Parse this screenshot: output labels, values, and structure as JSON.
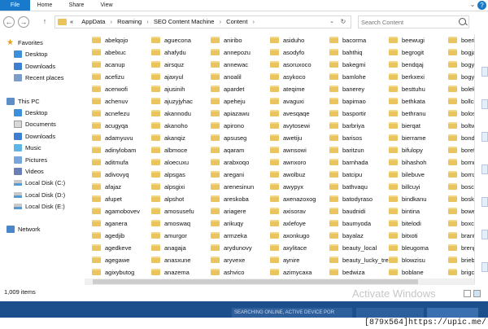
{
  "ribbon": {
    "tabs": [
      "File",
      "Home",
      "Share",
      "View"
    ],
    "help_label": "?"
  },
  "nav": {
    "back_glyph": "←",
    "forward_glyph": "→",
    "up_glyph": "↑",
    "breadcrumb": [
      "«",
      "AppData",
      "Roaming",
      "SEO Content Machine",
      "Content"
    ],
    "search_placeholder": "Search Content"
  },
  "sidebar": {
    "items": [
      {
        "label": "Favorites",
        "icon": "star-icon"
      },
      {
        "label": "Desktop",
        "icon": "desktop-icon"
      },
      {
        "label": "Downloads",
        "icon": "downloads-icon"
      },
      {
        "label": "Recent places",
        "icon": "recent-places-icon"
      },
      {
        "label": "This PC",
        "icon": "computer-icon"
      },
      {
        "label": "Desktop",
        "icon": "desktop-icon"
      },
      {
        "label": "Documents",
        "icon": "documents-icon"
      },
      {
        "label": "Downloads",
        "icon": "downloads-icon"
      },
      {
        "label": "Music",
        "icon": "music-icon"
      },
      {
        "label": "Pictures",
        "icon": "pictures-icon"
      },
      {
        "label": "Videos",
        "icon": "videos-icon"
      },
      {
        "label": "Local Disk (C:)",
        "icon": "disk-icon"
      },
      {
        "label": "Local Disk (D:)",
        "icon": "disk-icon"
      },
      {
        "label": "Local Disk (E:)",
        "icon": "disk-icon"
      },
      {
        "label": "Network",
        "icon": "network-icon"
      }
    ]
  },
  "folders": {
    "columns": [
      [
        "abelqojo",
        "abelxuc",
        "acanup",
        "acefizu",
        "acerwofi",
        "achenuv",
        "acnefezu",
        "acugyqa",
        "adamyuvu",
        "adinylobam",
        "aditmufa",
        "adivovyq",
        "afajaz",
        "afupet",
        "agamobovev",
        "aganera",
        "agedjib",
        "agedkeve",
        "agegawe",
        "agixybutog"
      ],
      [
        "aguecona",
        "ahafydu",
        "airsquz",
        "ajaxyul",
        "ajusinih",
        "ajuzyjyhac",
        "akannodu",
        "akanoho",
        "akanqiz",
        "albmoce",
        "aloecuxu",
        "alpsgas",
        "alpsgixi",
        "alpshot",
        "amosusefu",
        "amoswaq",
        "amurgor",
        "anagaja",
        "anasxune",
        "anazema"
      ],
      [
        "aniribo",
        "annepozu",
        "annewac",
        "anoalil",
        "apardet",
        "apeheju",
        "apiazawu",
        "apirono",
        "apsuseg",
        "aqaram",
        "arabxoqo",
        "aregani",
        "arenesinun",
        "areskoba",
        "ariagere",
        "arikuqy",
        "armzeka",
        "arydunovy",
        "aryvexe",
        "ashvico"
      ],
      [
        "asiduho",
        "asodyfo",
        "asoruxoco",
        "asykoco",
        "ateqime",
        "avaguxi",
        "avesqaqe",
        "avytosewi",
        "awetiju",
        "awnsowi",
        "awnxoro",
        "awolbuz",
        "awypyx",
        "axenazoxog",
        "axisorav",
        "axlefoye",
        "axonkugo",
        "axylitace",
        "aynire",
        "azimycaxa"
      ],
      [
        "bacorma",
        "bahthiq",
        "bakegmi",
        "bamlohe",
        "banerey",
        "bapimao",
        "basportir",
        "barbriya",
        "barisos",
        "baritzun",
        "barnhada",
        "batcipu",
        "bathvaqu",
        "batodyraso",
        "baudnidi",
        "baumyoda",
        "bayalaz",
        "beauty_local",
        "beauty_lucky_trend",
        "bedwiza"
      ],
      [
        "beewugi",
        "begrogit",
        "bendqaj",
        "berkxexi",
        "besttuhu",
        "bethkata",
        "bethranu",
        "bierqat",
        "bierrame",
        "bifulopy",
        "bihashoh",
        "bilebuve",
        "billcuyi",
        "bindkanu",
        "bintina",
        "bitelodi",
        "bitxoti",
        "bleugoma",
        "blowzisu",
        "boblane"
      ],
      [
        "boerina",
        "bogjaka",
        "bogyen",
        "bogyen",
        "bolekire",
        "bollciyi",
        "bolosim",
        "boltwev",
        "bondqe",
        "borefax",
        "bornmo",
        "bornxic",
        "boscayi",
        "boskov",
        "bowelle",
        "boxcodi",
        "brantuc",
        "brenpax",
        "briebob",
        "brigcaj"
      ]
    ]
  },
  "status": {
    "count": "1,009 items",
    "watermark": "Activate Windows"
  },
  "taskbar": {
    "items": [
      "SEARCHING ONLINE, ACTIVE DEVICE POR"
    ]
  },
  "footer": {
    "upic": "[879x564]https://upic.me/"
  }
}
